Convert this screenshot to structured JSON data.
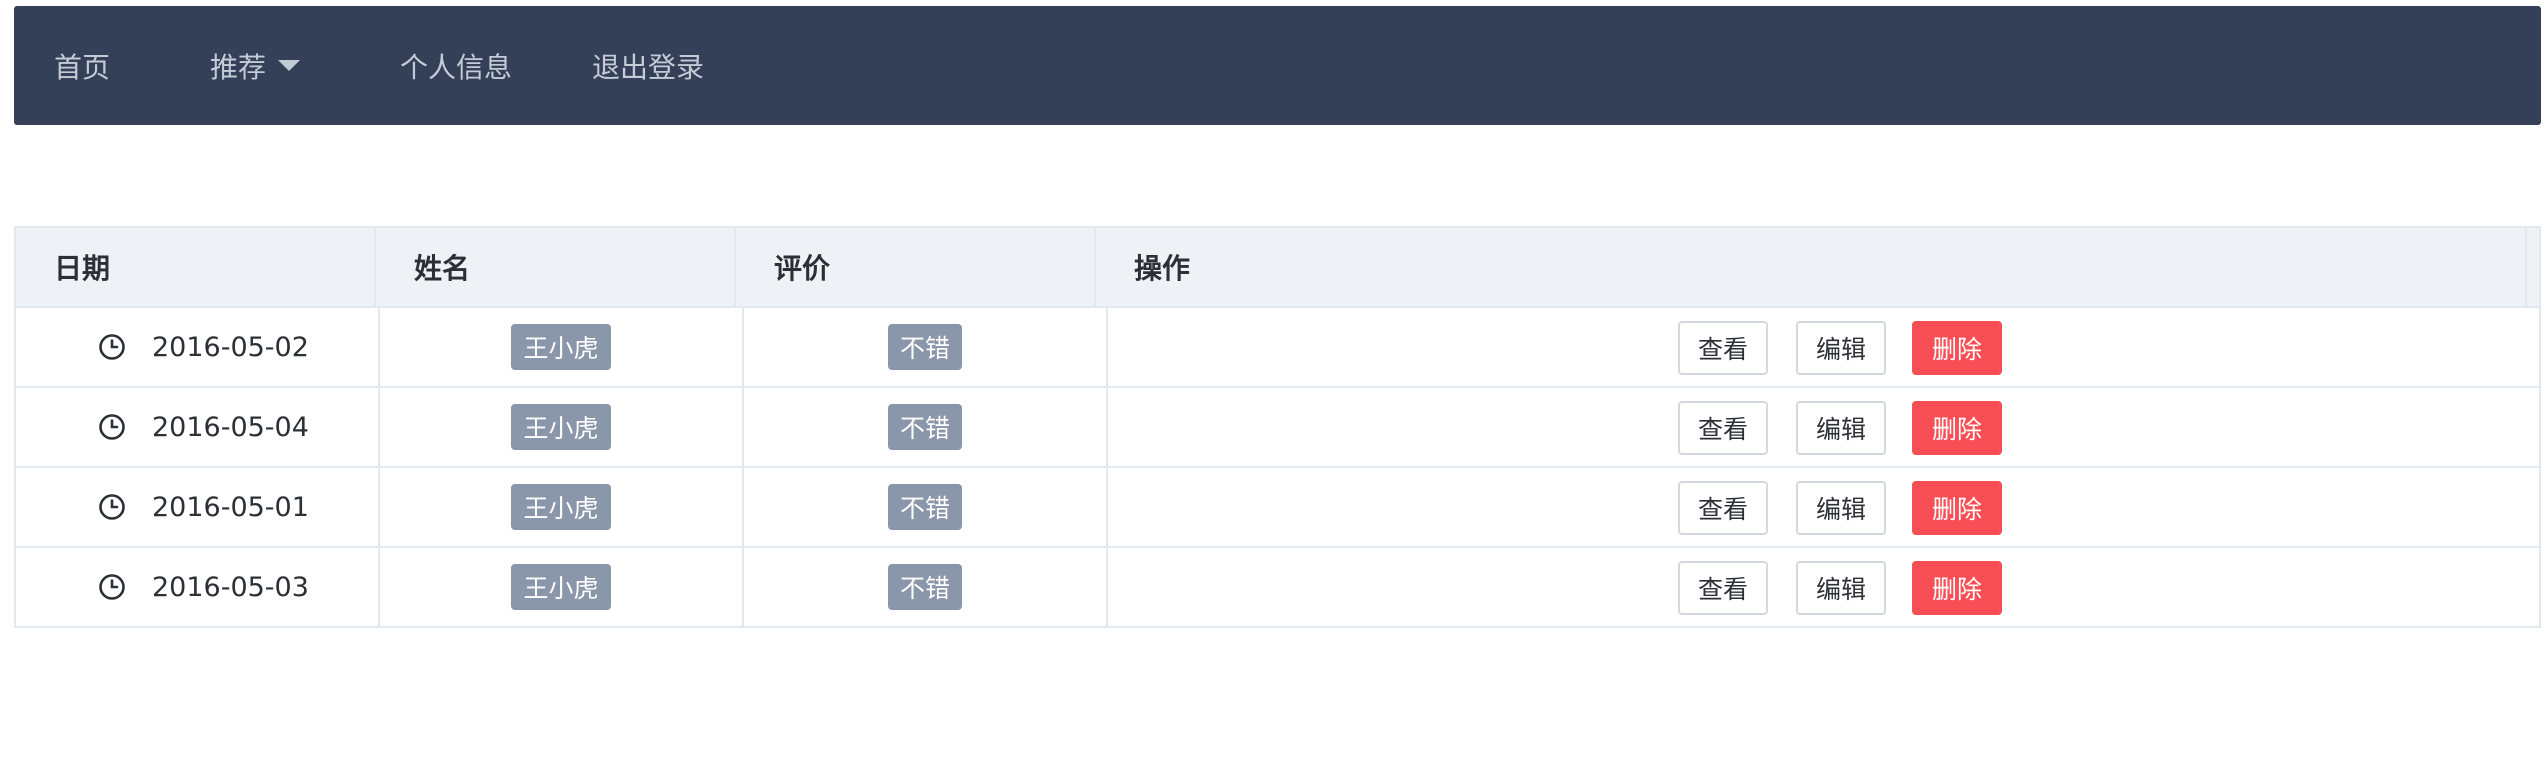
{
  "nav": {
    "home": "首页",
    "recommend": "推荐",
    "profile": "个人信息",
    "logout": "退出登录"
  },
  "table": {
    "headers": [
      "日期",
      "姓名",
      "评价",
      "操作"
    ],
    "rows": [
      {
        "date": "2016-05-02",
        "name": "王小虎",
        "rating": "不错",
        "view": "查看",
        "edit": "编辑",
        "delete": "删除"
      },
      {
        "date": "2016-05-04",
        "name": "王小虎",
        "rating": "不错",
        "view": "查看",
        "edit": "编辑",
        "delete": "删除"
      },
      {
        "date": "2016-05-01",
        "name": "王小虎",
        "rating": "不错",
        "view": "查看",
        "edit": "编辑",
        "delete": "删除"
      },
      {
        "date": "2016-05-03",
        "name": "王小虎",
        "rating": "不错",
        "view": "查看",
        "edit": "编辑",
        "delete": "删除"
      }
    ]
  },
  "colors": {
    "navbar_bg": "#344058",
    "tag_bg": "#8a96aa",
    "danger": "#f74f55",
    "header_bg": "#eef2f6"
  },
  "icons": {
    "dropdown": "caret-down-icon",
    "date": "clock-icon"
  }
}
